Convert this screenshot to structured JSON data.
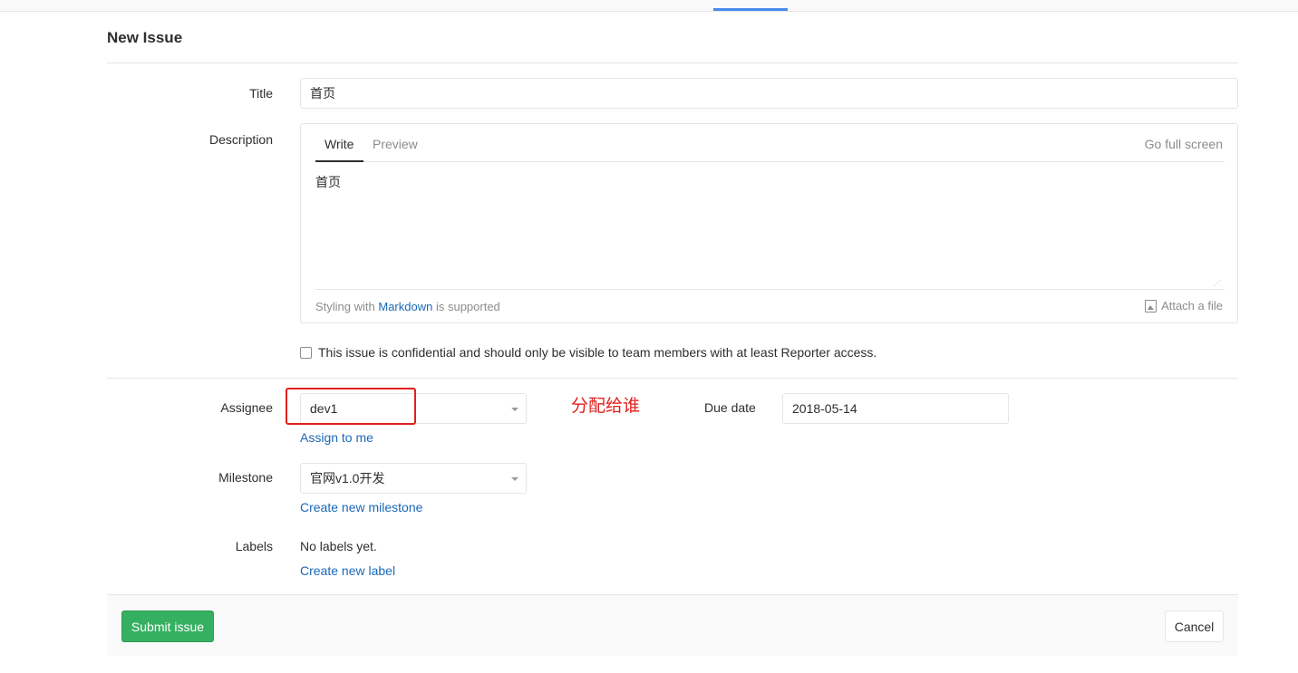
{
  "page": {
    "title": "New Issue"
  },
  "fields": {
    "title": {
      "label": "Title",
      "value": "首页"
    },
    "description": {
      "label": "Description",
      "tabs": [
        "Write",
        "Preview"
      ],
      "fullscreen_label": "Go full screen",
      "value": "首页",
      "styling_prefix": "Styling with",
      "markdown_link": "Markdown",
      "styling_suffix": "is supported",
      "attach_label": "Attach a file"
    },
    "confidential": {
      "label": "This issue is confidential and should only be visible to team members with at least Reporter access.",
      "checked": false
    },
    "assignee": {
      "label": "Assignee",
      "value": "dev1",
      "assign_me_link": "Assign to me"
    },
    "annotation": "分配给谁",
    "due_date": {
      "label": "Due date",
      "value": "2018-05-14"
    },
    "milestone": {
      "label": "Milestone",
      "value": "官网v1.0开发",
      "create_link": "Create new milestone"
    },
    "labels": {
      "label": "Labels",
      "value": "No labels yet.",
      "create_link": "Create new label"
    }
  },
  "actions": {
    "submit": "Submit issue",
    "cancel": "Cancel"
  },
  "colors": {
    "submit_bg": "#35b060",
    "link": "#1b69b6",
    "annotation": "#e0201c"
  },
  "icons": {
    "attach": "image-icon",
    "caret": "caret-down-icon"
  }
}
